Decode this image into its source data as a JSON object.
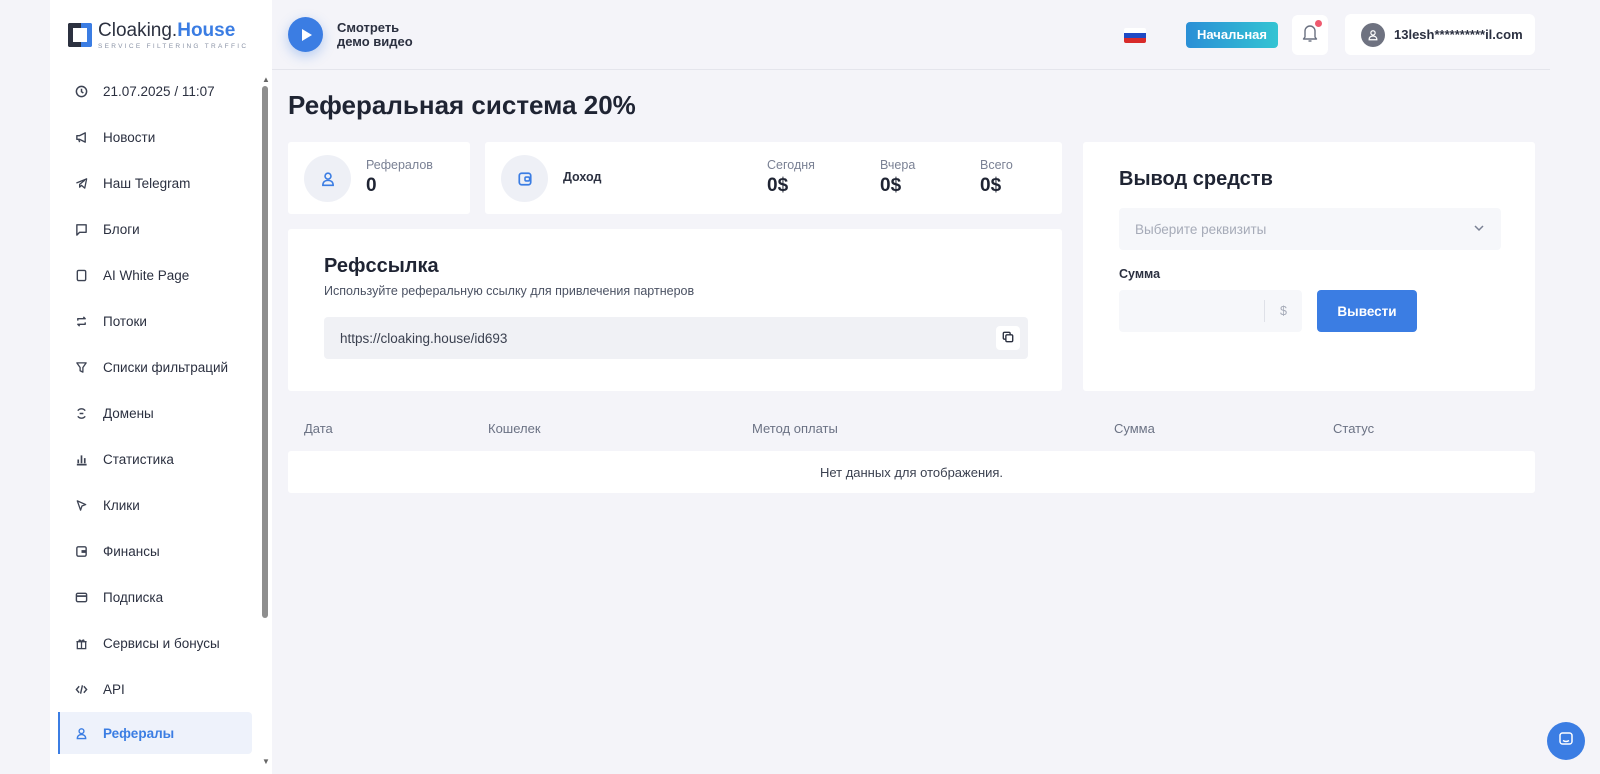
{
  "logo": {
    "title_main": "Cloaking.",
    "title_accent": "House",
    "subtitle": "SERVICE FILTERING TRAFFIC"
  },
  "sidebar": {
    "items": [
      {
        "label": "21.07.2025 / 11:07",
        "icon": "clock-icon"
      },
      {
        "label": "Новости",
        "icon": "megaphone-icon"
      },
      {
        "label": "Наш Telegram",
        "icon": "telegram-icon"
      },
      {
        "label": "Блоги",
        "icon": "chat-icon"
      },
      {
        "label": "AI White Page",
        "icon": "page-icon"
      },
      {
        "label": "Потоки",
        "icon": "repeat-icon"
      },
      {
        "label": "Списки фильтраций",
        "icon": "filter-icon"
      },
      {
        "label": "Домены",
        "icon": "domain-icon"
      },
      {
        "label": "Статистика",
        "icon": "bar-chart-icon"
      },
      {
        "label": "Клики",
        "icon": "cursor-icon"
      },
      {
        "label": "Финансы",
        "icon": "wallet-icon"
      },
      {
        "label": "Подписка",
        "icon": "card-icon"
      },
      {
        "label": "Сервисы и бонусы",
        "icon": "gift-icon"
      },
      {
        "label": "API",
        "icon": "code-icon"
      },
      {
        "label": "Рефералы",
        "icon": "user-icon",
        "active": true
      }
    ]
  },
  "header": {
    "demo_line1": "Смотреть",
    "demo_line2": "демо видео",
    "home_button": "Начальная",
    "user_email": "13lesh**********il.com"
  },
  "page": {
    "title": "Реферальная система 20%"
  },
  "referrals": {
    "label": "Рефералов",
    "value": "0"
  },
  "income": {
    "label": "Доход",
    "today_label": "Сегодня",
    "today_value": "0$",
    "yesterday_label": "Вчера",
    "yesterday_value": "0$",
    "total_label": "Всего",
    "total_value": "0$"
  },
  "ref_link": {
    "title": "Рефссылка",
    "subtitle": "Используйте реферальную ссылку для привлечения партнеров",
    "url": "https://cloaking.house/id693"
  },
  "withdraw": {
    "title": "Вывод средств",
    "select_placeholder": "Выберите реквизиты",
    "sum_label": "Сумма",
    "currency": "$",
    "button": "Вывести"
  },
  "table": {
    "columns": [
      "Дата",
      "Кошелек",
      "Метод оплаты",
      "Сумма",
      "Статус"
    ],
    "empty": "Нет данных для отображения."
  },
  "colors": {
    "accent": "#3b7de3",
    "background": "#f4f4f9",
    "dark": "#1f2433"
  }
}
